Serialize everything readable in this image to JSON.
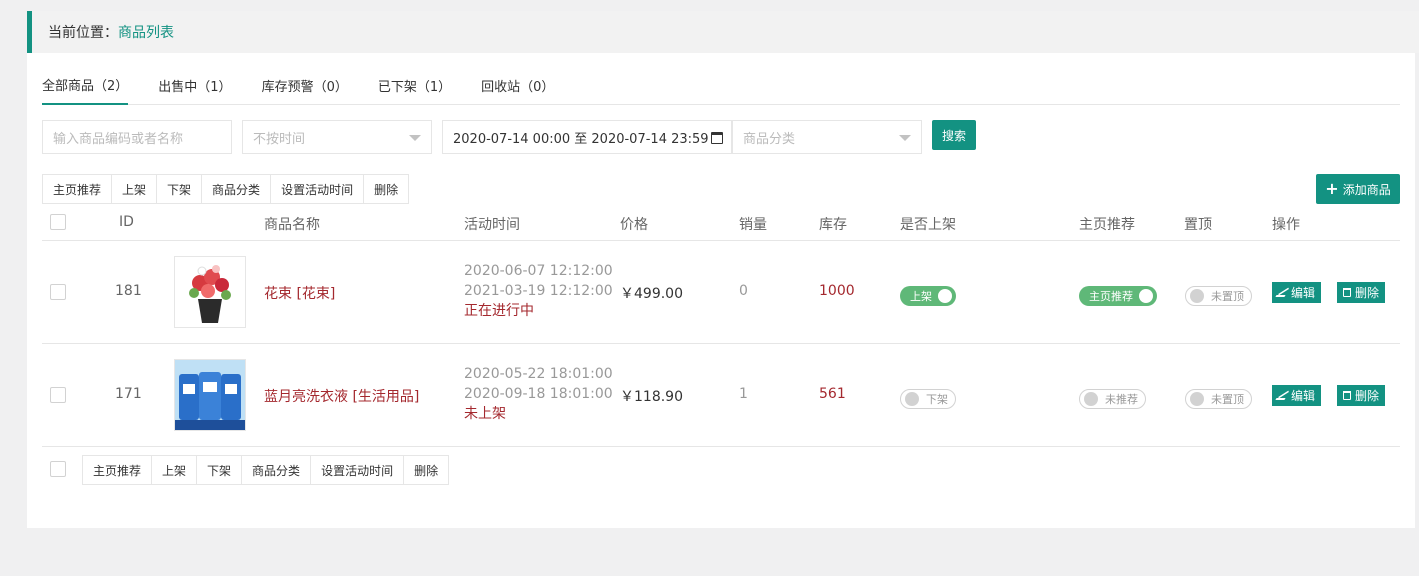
{
  "breadcrumb": {
    "prefix": "当前位置：",
    "current": "商品列表"
  },
  "tabs": [
    {
      "label": "全部商品（2）",
      "active": true
    },
    {
      "label": "出售中（1）",
      "active": false
    },
    {
      "label": "库存预警（0）",
      "active": false
    },
    {
      "label": "已下架（1）",
      "active": false
    },
    {
      "label": "回收站（0）",
      "active": false
    }
  ],
  "filters": {
    "keyword_placeholder": "输入商品编码或者名称",
    "time_select": "不按时间",
    "date_range": "2020-07-14 00:00 至 2020-07-14 23:59",
    "category_select": "商品分类",
    "search_label": "搜索"
  },
  "bulk_actions": [
    "主页推荐",
    "上架",
    "下架",
    "商品分类",
    "设置活动时间",
    "删除"
  ],
  "add_button": "添加商品",
  "columns": {
    "id": "ID",
    "name": "商品名称",
    "time": "活动时间",
    "price": "价格",
    "sales": "销量",
    "stock": "库存",
    "on_shelf": "是否上架",
    "recommend": "主页推荐",
    "pin": "置顶",
    "actions": "操作"
  },
  "rows": [
    {
      "id": "181",
      "name": "花束 [花束]",
      "start": "2020-06-07 12:12:00",
      "end": "2021-03-19 12:12:00",
      "status": "正在进行中",
      "price": "￥499.00",
      "sales": "0",
      "stock": "1000",
      "shelf_label": "上架",
      "shelf_on": true,
      "recommend_label": "主页推荐",
      "recommend_on": true,
      "pin_label": "未置顶",
      "pin_on": false,
      "edit": "编辑",
      "delete": "删除"
    },
    {
      "id": "171",
      "name": "蓝月亮洗衣液 [生活用品]",
      "start": "2020-05-22 18:01:00",
      "end": "2020-09-18 18:01:00",
      "status": "未上架",
      "price": "￥118.90",
      "sales": "1",
      "stock": "561",
      "shelf_label": "下架",
      "shelf_on": false,
      "recommend_label": "未推荐",
      "recommend_on": false,
      "pin_label": "未置顶",
      "pin_on": false,
      "edit": "编辑",
      "delete": "删除"
    }
  ],
  "colors": {
    "accent": "#139282",
    "danger_text": "#a4282e",
    "switch_on": "#5fb878"
  }
}
